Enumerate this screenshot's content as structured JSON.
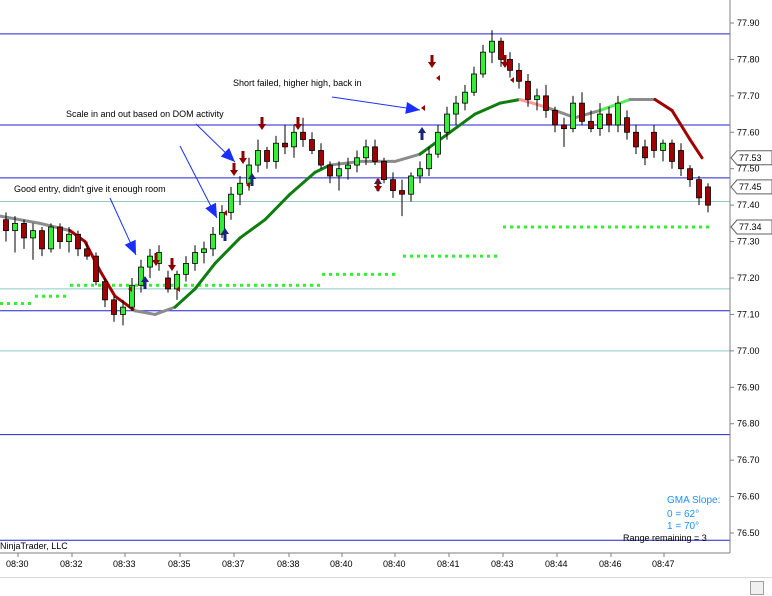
{
  "chart_data": {
    "type": "candlestick",
    "y_ticks": [
      "77.90",
      "77.80",
      "77.70",
      "77.60",
      "77.50",
      "77.40",
      "77.30",
      "77.20",
      "77.10",
      "77.00",
      "76.90",
      "76.80",
      "76.70",
      "76.60",
      "76.50"
    ],
    "x_ticks": [
      "08:30",
      "08:32",
      "08:33",
      "08:35",
      "08:37",
      "08:38",
      "08:40",
      "08:40",
      "08:41",
      "08:43",
      "08:44",
      "08:46",
      "08:47"
    ],
    "price_labels": [
      "77.53",
      "77.45",
      "77.34"
    ],
    "annotations": [
      "Good entry, didn't give it enough room",
      "Scale in and out based on DOM activity",
      "Short failed, higher high, back in"
    ],
    "copyright": "NinjaTrader, LLC",
    "gma_slope": {
      "title": "GMA Slope:",
      "line0": "0 = 62°",
      "line1": "1 = 70°"
    },
    "range_remaining": "Range remaining = 3",
    "horizontal_levels": [
      77.87,
      77.62,
      77.475,
      77.11,
      76.77,
      76.48
    ],
    "teal_levels": [
      77.41,
      77.17,
      77.0
    ],
    "candles": [
      [
        77.36,
        77.38,
        77.3,
        77.33
      ],
      [
        77.33,
        77.37,
        77.27,
        77.35
      ],
      [
        77.35,
        77.36,
        77.28,
        77.31
      ],
      [
        77.31,
        77.35,
        77.25,
        77.33
      ],
      [
        77.33,
        77.34,
        77.26,
        77.28
      ],
      [
        77.28,
        77.35,
        77.27,
        77.34
      ],
      [
        77.34,
        77.35,
        77.28,
        77.3
      ],
      [
        77.3,
        77.34,
        77.27,
        77.32
      ],
      [
        77.32,
        77.33,
        77.26,
        77.28
      ],
      [
        77.28,
        77.3,
        77.25,
        77.26
      ],
      [
        77.26,
        77.27,
        77.18,
        77.19
      ],
      [
        77.19,
        77.2,
        77.12,
        77.14
      ],
      [
        77.14,
        77.15,
        77.08,
        77.1
      ],
      [
        77.1,
        77.14,
        77.07,
        77.12
      ],
      [
        77.12,
        77.2,
        77.11,
        77.18
      ],
      [
        77.18,
        77.25,
        77.16,
        77.23
      ],
      [
        77.23,
        77.28,
        77.2,
        77.26
      ],
      [
        77.24,
        77.29,
        77.22,
        77.27
      ],
      [
        77.2,
        77.22,
        77.16,
        77.17
      ],
      [
        77.17,
        77.22,
        77.14,
        77.21
      ],
      [
        77.21,
        77.26,
        77.19,
        77.24
      ],
      [
        77.24,
        77.29,
        77.22,
        77.27
      ],
      [
        77.27,
        77.3,
        77.24,
        77.28
      ],
      [
        77.28,
        77.34,
        77.26,
        77.32
      ],
      [
        77.32,
        77.4,
        77.31,
        77.38
      ],
      [
        77.38,
        77.45,
        77.36,
        77.43
      ],
      [
        77.43,
        77.48,
        77.4,
        77.46
      ],
      [
        77.46,
        77.53,
        77.44,
        77.51
      ],
      [
        77.51,
        77.58,
        77.49,
        77.55
      ],
      [
        77.55,
        77.56,
        77.5,
        77.52
      ],
      [
        77.52,
        77.59,
        77.5,
        77.57
      ],
      [
        77.57,
        77.62,
        77.54,
        77.56
      ],
      [
        77.56,
        77.62,
        77.53,
        77.6
      ],
      [
        77.6,
        77.64,
        77.56,
        77.58
      ],
      [
        77.58,
        77.6,
        77.54,
        77.55
      ],
      [
        77.55,
        77.57,
        77.5,
        77.51
      ],
      [
        77.51,
        77.52,
        77.46,
        77.48
      ],
      [
        77.48,
        77.52,
        77.44,
        77.5
      ],
      [
        77.5,
        77.53,
        77.47,
        77.51
      ],
      [
        77.51,
        77.55,
        77.49,
        77.53
      ],
      [
        77.53,
        77.58,
        77.51,
        77.56
      ],
      [
        77.56,
        77.58,
        77.51,
        77.52
      ],
      [
        77.52,
        77.53,
        77.46,
        77.47
      ],
      [
        77.47,
        77.49,
        77.42,
        77.44
      ],
      [
        77.44,
        77.47,
        77.37,
        77.43
      ],
      [
        77.43,
        77.49,
        77.41,
        77.48
      ],
      [
        77.48,
        77.52,
        77.46,
        77.5
      ],
      [
        77.5,
        77.56,
        77.48,
        77.54
      ],
      [
        77.54,
        77.62,
        77.53,
        77.6
      ],
      [
        77.6,
        77.67,
        77.58,
        77.65
      ],
      [
        77.65,
        77.7,
        77.62,
        77.68
      ],
      [
        77.68,
        77.73,
        77.66,
        77.71
      ],
      [
        77.71,
        77.78,
        77.7,
        77.76
      ],
      [
        77.76,
        77.84,
        77.75,
        77.82
      ],
      [
        77.82,
        77.88,
        77.79,
        77.85
      ],
      [
        77.85,
        77.86,
        77.78,
        77.8
      ],
      [
        77.8,
        77.82,
        77.75,
        77.77
      ],
      [
        77.77,
        77.79,
        77.72,
        77.74
      ],
      [
        77.74,
        77.76,
        77.67,
        77.69
      ],
      [
        77.69,
        77.72,
        77.66,
        77.7
      ],
      [
        77.7,
        77.73,
        77.64,
        77.66
      ],
      [
        77.66,
        77.67,
        77.6,
        77.62
      ],
      [
        77.62,
        77.64,
        77.56,
        77.61
      ],
      [
        77.61,
        77.7,
        77.6,
        77.68
      ],
      [
        77.68,
        77.71,
        77.62,
        77.63
      ],
      [
        77.63,
        77.66,
        77.6,
        77.61
      ],
      [
        77.61,
        77.68,
        77.59,
        77.65
      ],
      [
        77.65,
        77.67,
        77.6,
        77.62
      ],
      [
        77.62,
        77.7,
        77.6,
        77.68
      ],
      [
        77.64,
        77.66,
        77.58,
        77.6
      ],
      [
        77.6,
        77.62,
        77.54,
        77.56
      ],
      [
        77.56,
        77.58,
        77.51,
        77.53
      ],
      [
        77.6,
        77.62,
        77.53,
        77.55
      ],
      [
        77.55,
        77.58,
        77.52,
        77.57
      ],
      [
        77.57,
        77.58,
        77.5,
        77.52
      ],
      [
        77.55,
        77.57,
        77.48,
        77.5
      ],
      [
        77.5,
        77.51,
        77.45,
        77.47
      ],
      [
        77.47,
        77.48,
        77.4,
        77.42
      ],
      [
        77.45,
        77.46,
        77.38,
        77.4
      ]
    ]
  }
}
